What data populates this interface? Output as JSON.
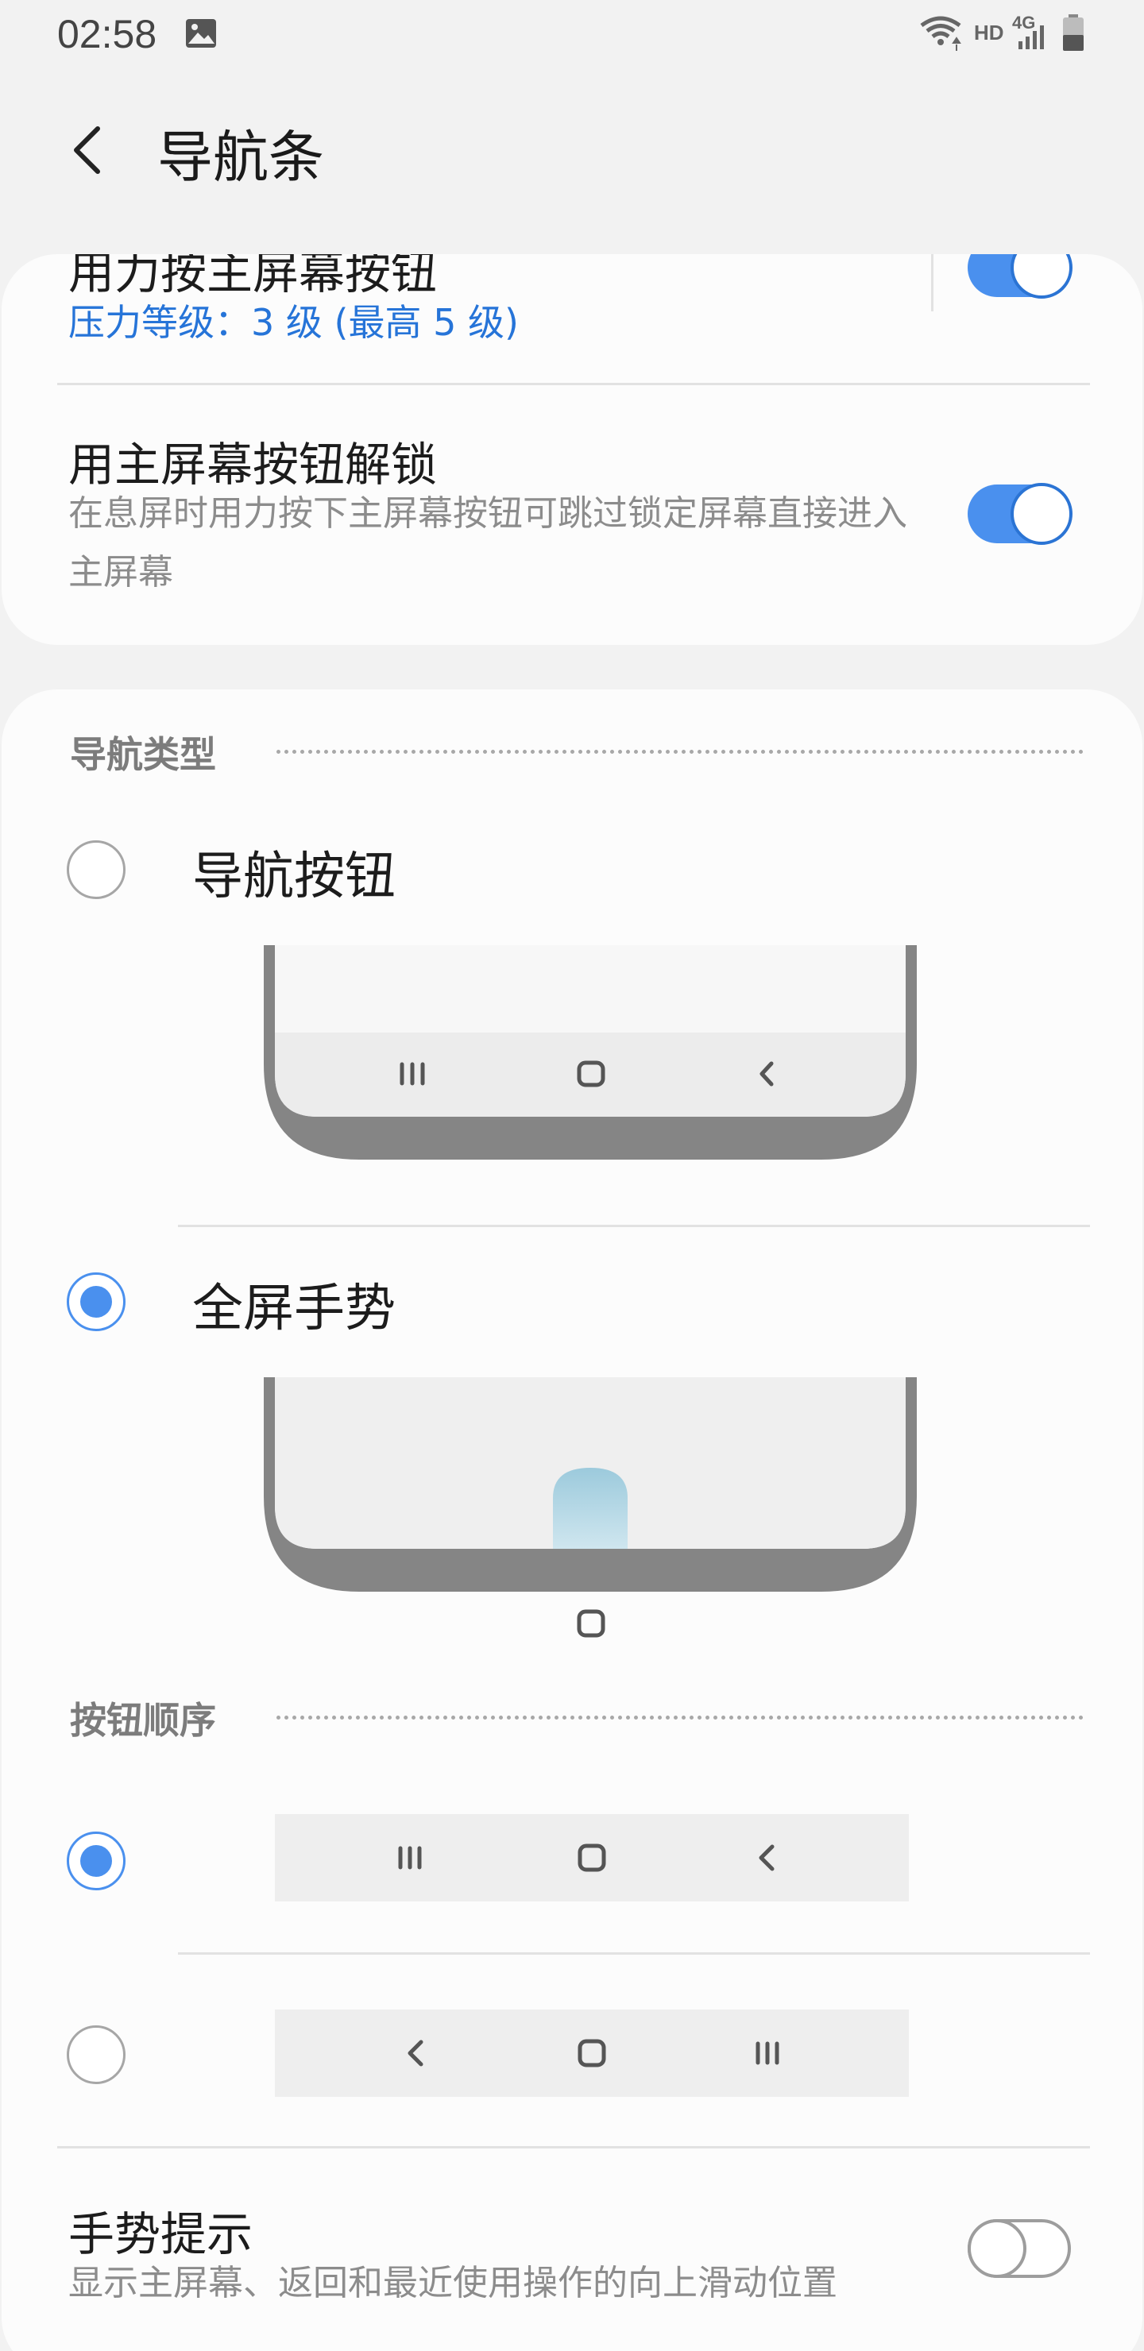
{
  "status_bar": {
    "time": "02:58",
    "network_label": "HD",
    "network_type": "4G",
    "icons": [
      "gallery-icon",
      "wifi-icon",
      "signal-icon",
      "battery-icon"
    ]
  },
  "header": {
    "title": "导航条",
    "back_icon": "chevron-left-icon"
  },
  "settings": {
    "force_press": {
      "title": "用力按主屏幕按钮",
      "value": "压力等级：3 级 (最高 5 级)",
      "enabled": true
    },
    "unlock": {
      "title": "用主屏幕按钮解锁",
      "description": "在息屏时用力按下主屏幕按钮可跳过锁定屏幕直接进入主屏幕",
      "enabled": true
    }
  },
  "nav_type": {
    "heading": "导航类型",
    "options": [
      {
        "label": "导航按钮",
        "selected": false
      },
      {
        "label": "全屏手势",
        "selected": true
      }
    ]
  },
  "button_order": {
    "heading": "按钮顺序",
    "options": [
      {
        "selected": true,
        "order": [
          "recents-icon",
          "home-icon",
          "back-icon"
        ]
      },
      {
        "selected": false,
        "order": [
          "back-icon",
          "home-icon",
          "recents-icon"
        ]
      }
    ]
  },
  "gesture_hints": {
    "title": "手势提示",
    "description": "显示主屏幕、返回和最近使用操作的向上滑动位置",
    "enabled": false
  },
  "colors": {
    "accent": "#4a90ee",
    "link_blue": "#2674d8",
    "gesture_handle": "#a8d4e4"
  }
}
